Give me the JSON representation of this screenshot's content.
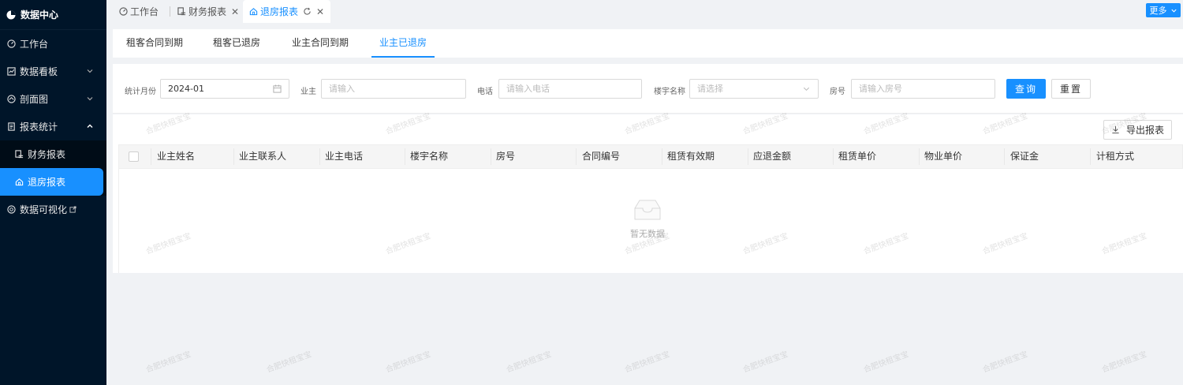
{
  "sidebar": {
    "brand": "数据中心",
    "items": [
      {
        "label": "工作台"
      },
      {
        "label": "数据看板"
      },
      {
        "label": "剖面图"
      },
      {
        "label": "报表统计"
      }
    ],
    "submenu": [
      {
        "label": "财务报表"
      },
      {
        "label": "退房报表"
      }
    ],
    "last_item": {
      "label": "数据可视化"
    }
  },
  "tagsbar": {
    "tags": [
      {
        "label": "工作台"
      },
      {
        "label": "财务报表"
      },
      {
        "label": "退房报表"
      }
    ],
    "more_label": "更多"
  },
  "subtabs": [
    {
      "label": "租客合同到期"
    },
    {
      "label": "租客已退房"
    },
    {
      "label": "业主合同到期"
    },
    {
      "label": "业主已退房"
    }
  ],
  "filters": {
    "month_label": "统计月份",
    "month_value": "2024-01",
    "owner_label": "业主",
    "owner_placeholder": "请输入",
    "phone_label": "电话",
    "phone_placeholder": "请输入电话",
    "building_label": "楼宇名称",
    "building_placeholder": "请选择",
    "room_label": "房号",
    "room_placeholder": "请输入房号",
    "query_label": "查询",
    "reset_label": "重置"
  },
  "table": {
    "export_label": "导出报表",
    "columns": [
      "业主姓名",
      "业主联系人",
      "业主电话",
      "楼宇名称",
      "房号",
      "合同编号",
      "租赁有效期",
      "应退金额",
      "租赁单价",
      "物业单价",
      "保证金",
      "计租方式"
    ],
    "empty_text": "暂无数据"
  },
  "watermark": "合肥快租宝宝",
  "colors": {
    "sidebar_bg": "#001529",
    "primary": "#1890ff"
  }
}
